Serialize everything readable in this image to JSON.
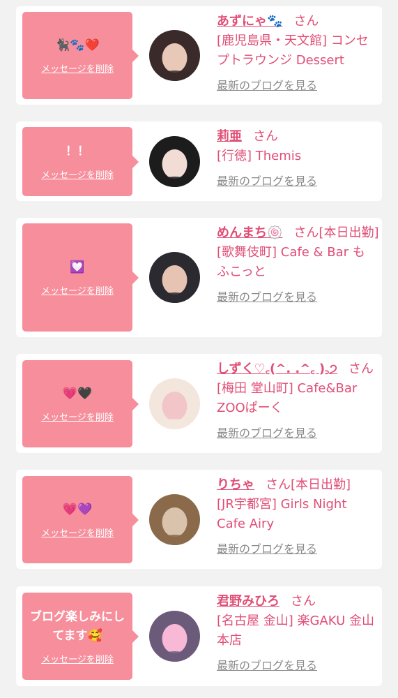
{
  "colors": {
    "accent": "#e14d75",
    "bubble": "#f78e9c",
    "link_gray": "#8a8a8a"
  },
  "items": [
    {
      "message": "🐈‍⬛🐾❤️",
      "delete_label": "メッセージを削除",
      "name": "あずにゃ🐾",
      "san": "さん",
      "shop": "[鹿児島県・天文館] コンセプトラウンジ Dessert",
      "blog_label": "最新のブログを見る",
      "avatar_colors": [
        "#3a2a2a",
        "#e8c9b8"
      ]
    },
    {
      "message": "！！",
      "delete_label": "メッセージを削除",
      "name": "莉亜",
      "san": "さん",
      "shop": "[行徳] Themis",
      "blog_label": "最新のブログを見る",
      "avatar_colors": [
        "#1c1c1c",
        "#f1dcd6"
      ]
    },
    {
      "message": "💟",
      "delete_label": "メッセージを削除",
      "name": "めんまち🍥",
      "san": "さん[本日出勤]",
      "shop": "[歌舞伎町] Cafe & Bar もふこっと",
      "blog_label": "最新のブログを見る",
      "avatar_colors": [
        "#2a2a30",
        "#e6c3b3"
      ]
    },
    {
      "message": "💗🖤",
      "delete_label": "メッセージを削除",
      "name": "しずく♡꜀(^. .^꜀ )꜆੭",
      "san": "さん",
      "shop": "[梅田 堂山町] Cafe&Bar ZOOぱーく",
      "blog_label": "最新のブログを見る",
      "avatar_colors": [
        "#f3e6dd",
        "#f2c6c9"
      ]
    },
    {
      "message": "💗💜",
      "delete_label": "メッセージを削除",
      "name": "りちゃ",
      "san": "さん[本日出勤]",
      "shop": "[JR宇都宮] Girls Night Cafe Airy",
      "blog_label": "最新のブログを見る",
      "avatar_colors": [
        "#8a6a4a",
        "#d9c3ad"
      ]
    },
    {
      "message": "ブログ楽しみにしてます🥰",
      "delete_label": "メッセージを削除",
      "name": "君野みひろ",
      "san": "さん",
      "shop": "[名古屋 金山] 楽GAKU 金山本店",
      "blog_label": "最新のブログを見る",
      "avatar_colors": [
        "#6b5a7a",
        "#f7b9d6"
      ]
    }
  ]
}
